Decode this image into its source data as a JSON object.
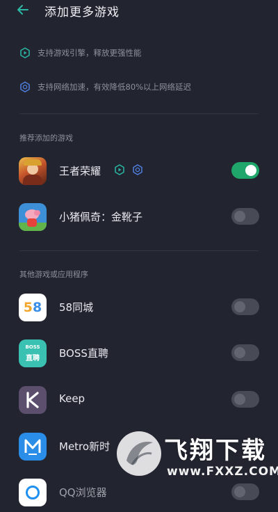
{
  "header": {
    "title": "添加更多游戏"
  },
  "features": [
    {
      "icon": "hexagon-game-icon",
      "text": "支持游戏引擎，释放更强性能"
    },
    {
      "icon": "network-accel-icon",
      "text": "支持网络加速，有效降低80%以上网络延迟"
    }
  ],
  "sections": {
    "recommended": "推荐添加的游戏",
    "others": "其他游戏或应用程序"
  },
  "recommended_apps": [
    {
      "name": "王者荣耀",
      "enabled": true
    },
    {
      "name": "小猪佩奇：金靴子",
      "enabled": false
    }
  ],
  "other_apps": [
    {
      "name": "58同城",
      "icon_text": "58",
      "enabled": false
    },
    {
      "name": "BOSS直聘",
      "icon_text": "BOSS\n直聘",
      "enabled": false
    },
    {
      "name": "Keep",
      "icon_text": "K",
      "enabled": false
    },
    {
      "name": "Metro新时",
      "icon_text": "M",
      "enabled": false
    },
    {
      "name": "QQ浏览器",
      "enabled": false
    }
  ],
  "watermark": {
    "brand": "飞翔下载",
    "url": "www.FXXZ.COM"
  },
  "colors": {
    "background": "#22242f",
    "toggle_on": "#20a66a",
    "accent": "#2bb8a6"
  }
}
